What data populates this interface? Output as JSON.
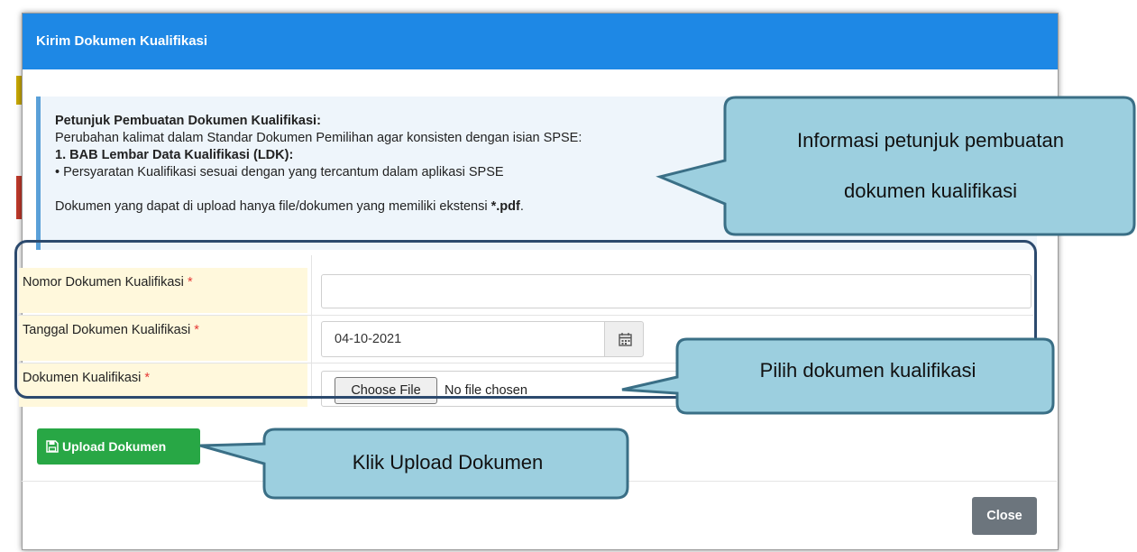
{
  "modal": {
    "title": "Kirim Dokumen Kualifikasi"
  },
  "info": {
    "heading": "Petunjuk Pembuatan Dokumen Kualifikasi:",
    "line1": "Perubahan kalimat dalam Standar Dokumen Pemilihan agar konsisten dengan isian SPSE:",
    "section": "1. BAB Lembar Data Kualifikasi (LDK):",
    "bullet": "• Persyaratan Kualifikasi sesuai dengan yang tercantum dalam aplikasi SPSE",
    "upload_note_prefix": "Dokumen yang dapat di upload hanya file/dokumen yang memiliki ekstensi ",
    "upload_note_ext": "*.pdf",
    "upload_note_suffix": "."
  },
  "form": {
    "nomor_label": "Nomor Dokumen Kualifikasi",
    "nomor_value": "",
    "tanggal_label": "Tanggal Dokumen Kualifikasi",
    "tanggal_value": "04-10-2021",
    "dokumen_label": "Dokumen Kualifikasi",
    "required_mark": "*",
    "choose_file_label": "Choose File",
    "no_file_text": "No file chosen"
  },
  "buttons": {
    "upload_label": "Upload Dokumen",
    "close_label": "Close"
  },
  "callouts": {
    "info_line1": "Informasi petunjuk pembuatan",
    "info_line2": "dokumen kualifikasi",
    "pilih": "Pilih dokumen kualifikasi",
    "klik": "Klik Upload Dokumen"
  },
  "icons": {
    "calendar": "calendar-icon",
    "save": "floppy-disk-icon"
  },
  "colors": {
    "header": "#1e88e5",
    "upload_button": "#28a745",
    "close_button": "#6c757d",
    "callout_fill": "#9ccfdf",
    "callout_border": "#3a6f86",
    "form_border": "#2c4a6e"
  }
}
